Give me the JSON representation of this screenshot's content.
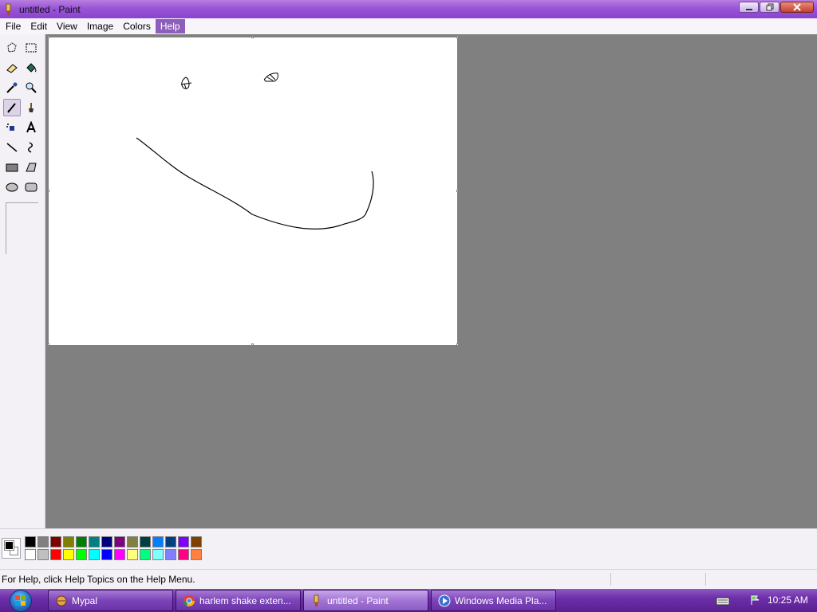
{
  "window": {
    "title": "untitled - Paint"
  },
  "menu": [
    {
      "label": "File",
      "active": false
    },
    {
      "label": "Edit",
      "active": false
    },
    {
      "label": "View",
      "active": false
    },
    {
      "label": "Image",
      "active": false
    },
    {
      "label": "Colors",
      "active": false
    },
    {
      "label": "Help",
      "active": true
    }
  ],
  "tools": [
    {
      "icon": "free-form-select-icon"
    },
    {
      "icon": "rect-select-icon"
    },
    {
      "icon": "eraser-icon"
    },
    {
      "icon": "fill-bucket-icon"
    },
    {
      "icon": "color-picker-icon"
    },
    {
      "icon": "magnifier-icon"
    },
    {
      "icon": "pencil-icon",
      "selected": true
    },
    {
      "icon": "brush-icon"
    },
    {
      "icon": "airbrush-icon"
    },
    {
      "icon": "text-icon"
    },
    {
      "icon": "line-icon"
    },
    {
      "icon": "curve-icon"
    },
    {
      "icon": "rectangle-icon"
    },
    {
      "icon": "polygon-icon"
    },
    {
      "icon": "ellipse-icon"
    },
    {
      "icon": "rounded-rectangle-icon"
    }
  ],
  "colors": {
    "foreground": "#000000",
    "background": "#ffffff",
    "palette_top": [
      "#000000",
      "#808080",
      "#800000",
      "#808000",
      "#008000",
      "#008080",
      "#000080",
      "#800080",
      "#808040",
      "#004040",
      "#0080ff",
      "#004080",
      "#8000ff",
      "#804000"
    ],
    "palette_bottom": [
      "#ffffff",
      "#c0c0c0",
      "#ff0000",
      "#ffff00",
      "#00ff00",
      "#00ffff",
      "#0000ff",
      "#ff00ff",
      "#ffff80",
      "#00ff80",
      "#80ffff",
      "#8080ff",
      "#ff0080",
      "#ff8040"
    ]
  },
  "status": {
    "help_text": "For Help, click Help Topics on the Help Menu."
  },
  "taskbar": {
    "items": [
      {
        "label": "Mypal",
        "icon": "mypal-icon",
        "active": false
      },
      {
        "label": "harlem shake exten...",
        "icon": "chrome-icon",
        "active": false
      },
      {
        "label": "untitled - Paint",
        "icon": "paint-icon",
        "active": true
      },
      {
        "label": "Windows Media Pla...",
        "icon": "media-player-icon",
        "active": false
      }
    ],
    "clock": "10:25 AM"
  }
}
